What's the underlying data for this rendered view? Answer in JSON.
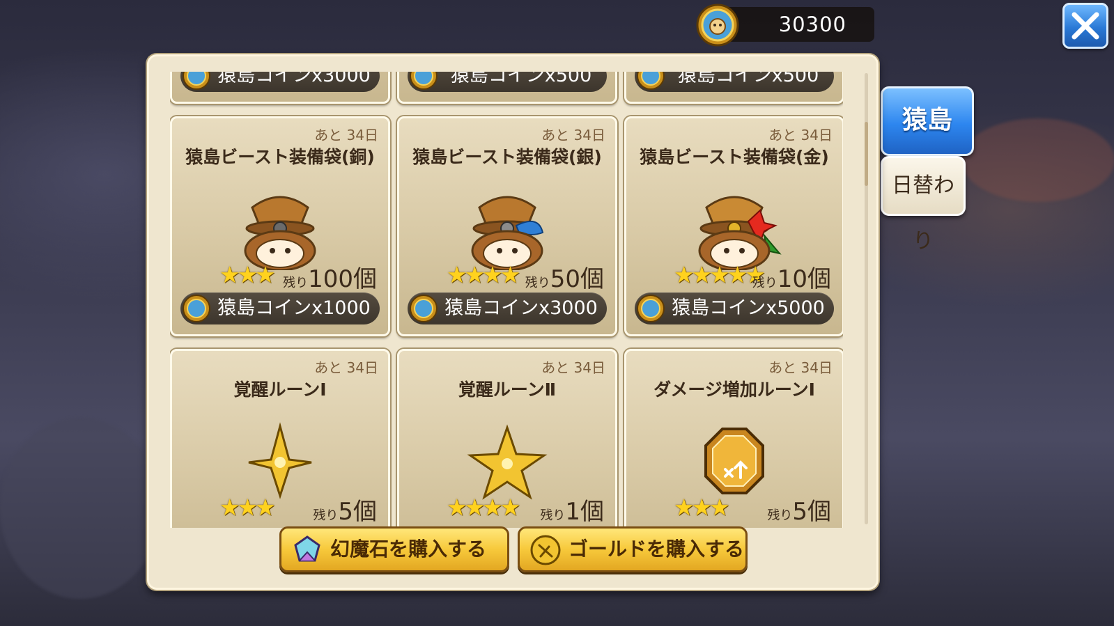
{
  "header": {
    "coin_amount": "30300"
  },
  "close_label": "close",
  "tabs": [
    {
      "label": "猿島",
      "active": true
    },
    {
      "label": "日替わり",
      "active": false
    }
  ],
  "top_row_prices": [
    "猿島コインx3000",
    "猿島コインx500",
    "猿島コインx500"
  ],
  "items": [
    {
      "days": "あと 34日",
      "title": "猿島ビースト装備袋(銅)",
      "stars": "★★★",
      "remain_prefix": "残り",
      "remain_count": "100個",
      "price": "猿島コインx1000",
      "icon": "monkey-bag-bronze-icon"
    },
    {
      "days": "あと 34日",
      "title": "猿島ビースト装備袋(銀)",
      "stars": "★★★★",
      "remain_prefix": "残り",
      "remain_count": "50個",
      "price": "猿島コインx3000",
      "icon": "monkey-bag-silver-icon"
    },
    {
      "days": "あと 34日",
      "title": "猿島ビースト装備袋(金)",
      "stars": "★★★★★",
      "remain_prefix": "残り",
      "remain_count": "10個",
      "price": "猿島コインx5000",
      "icon": "monkey-bag-gold-icon"
    },
    {
      "days": "あと 34日",
      "title": "覚醒ルーンⅠ",
      "stars": "★★★",
      "remain_prefix": "残り",
      "remain_count": "5個",
      "icon": "awaken-rune-1-icon"
    },
    {
      "days": "あと 34日",
      "title": "覚醒ルーンⅡ",
      "stars": "★★★★",
      "remain_prefix": "残り",
      "remain_count": "1個",
      "icon": "awaken-rune-2-icon"
    },
    {
      "days": "あと 34日",
      "title": "ダメージ増加ルーンⅠ",
      "stars": "★★★",
      "remain_prefix": "残り",
      "remain_count": "5個",
      "icon": "damage-rune-icon"
    }
  ],
  "buttons": {
    "buy_gems": "幻魔石を購入する",
    "buy_gold": "ゴールドを購入する"
  },
  "colors": {
    "accent_blue": "#2d86ef",
    "panel": "#efe6cf",
    "button_gold": "#f7c93b"
  }
}
